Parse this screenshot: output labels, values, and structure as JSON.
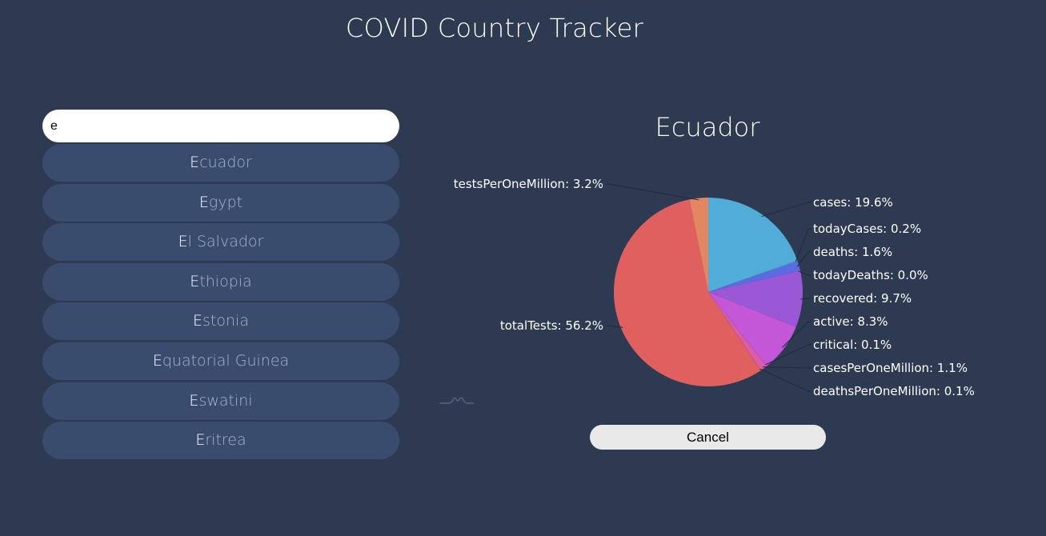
{
  "app": {
    "title": "COVID Country Tracker"
  },
  "search": {
    "value": "e"
  },
  "results": [
    {
      "match": "E",
      "rest": "cuador"
    },
    {
      "match": "E",
      "rest": "gypt"
    },
    {
      "match": "E",
      "rest": "l Salvador"
    },
    {
      "match": "E",
      "rest": "thiopia"
    },
    {
      "match": "E",
      "rest": "stonia"
    },
    {
      "match": "E",
      "rest": "quatorial Guinea"
    },
    {
      "match": "E",
      "rest": "swatini"
    },
    {
      "match": "E",
      "rest": "ritrea"
    }
  ],
  "detail": {
    "country": "Ecuador",
    "cancel_label": "Cancel"
  },
  "chart_data": {
    "type": "pie",
    "title": "Ecuador",
    "slices": [
      {
        "label": "cases",
        "percent": 19.6,
        "color": "#52acd8"
      },
      {
        "label": "todayCases",
        "percent": 0.2,
        "color": "#5a88d8"
      },
      {
        "label": "deaths",
        "percent": 1.6,
        "color": "#5a6ce0"
      },
      {
        "label": "todayDeaths",
        "percent": 0.0,
        "color": "#7a5ed8"
      },
      {
        "label": "recovered",
        "percent": 9.7,
        "color": "#9a58d6"
      },
      {
        "label": "active",
        "percent": 8.3,
        "color": "#c456d8"
      },
      {
        "label": "critical",
        "percent": 0.1,
        "color": "#d558c8"
      },
      {
        "label": "casesPerOneMillion",
        "percent": 1.1,
        "color": "#dc5ca8"
      },
      {
        "label": "deathsPerOneMillion",
        "percent": 0.1,
        "color": "#de5c88"
      },
      {
        "label": "totalTests",
        "percent": 56.2,
        "color": "#e0605f"
      },
      {
        "label": "testsPerOneMillion",
        "percent": 3.2,
        "color": "#e28762"
      }
    ]
  }
}
